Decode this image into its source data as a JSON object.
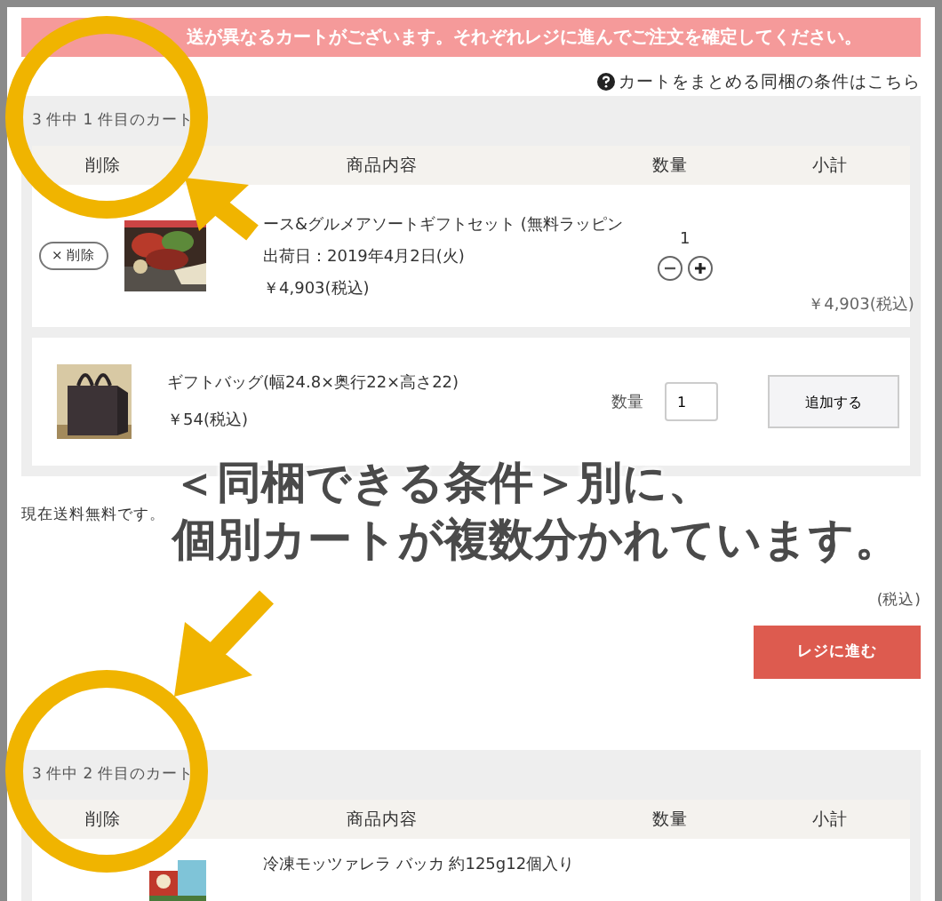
{
  "banner": {
    "text": "送が異なるカートがございます。それぞれレジに進んでご注文を確定してください。"
  },
  "help_link": {
    "text": "カートをまとめる同梱の条件はこちら"
  },
  "carts": [
    {
      "title": "3 件中 1 件目のカート",
      "columns": [
        "削除",
        "商品内容",
        "数量",
        "小計"
      ],
      "items": [
        {
          "kind": "product",
          "delete_label": "× 削除",
          "name": "ース&グルメアソートギフトセット (無料ラッピン",
          "ship_date": "出荷日：2019年4月2日(火)",
          "price": "￥4,903(税込)",
          "quantity": "1",
          "subtotal": "￥4,903(税込)"
        }
      ],
      "addon": {
        "name": "ギフトバッグ(幅24.8×奥行22×高さ22)",
        "price": "￥54(税込)",
        "quantity_label": "数量",
        "quantity": "1",
        "button": "追加する"
      },
      "shipping_note": "現在送料無料です。",
      "total_tax": "(税込)",
      "checkout_button": "レジに進む"
    },
    {
      "title": "3 件中 2 件目のカート",
      "columns": [
        "削除",
        "商品内容",
        "数量",
        "小計"
      ],
      "items": [
        {
          "kind": "product",
          "name": "冷凍モッツァレラ バッカ 約125g12個入り"
        }
      ]
    }
  ],
  "caption": [
    "＜同梱できる条件＞別に、",
    "個別カートが複数分かれています。"
  ]
}
